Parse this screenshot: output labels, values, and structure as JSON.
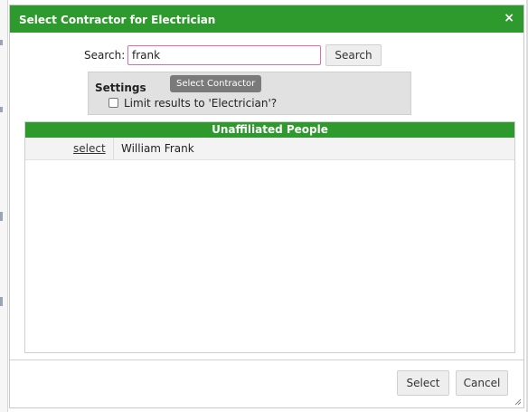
{
  "dialog": {
    "title": "Select Contractor for Electrician",
    "close_glyph": "×"
  },
  "search": {
    "label": "Search:",
    "value": "frank",
    "button_label": "Search"
  },
  "settings": {
    "heading": "Settings",
    "limit_label": "Limit results to 'Electrician'?",
    "limit_checked": false
  },
  "tooltip": {
    "text": "Select Contractor"
  },
  "results": {
    "header": "Unaffiliated People",
    "rows": [
      {
        "action": "select",
        "name": "William Frank"
      }
    ]
  },
  "footer": {
    "select_label": "Select",
    "cancel_label": "Cancel"
  },
  "icons": {
    "resize": "resize-grip-icon"
  },
  "colors": {
    "accent": "#2e9a2e",
    "input_focus_border": "#e26ab0",
    "tooltip_bg": "#7a7a7a"
  }
}
